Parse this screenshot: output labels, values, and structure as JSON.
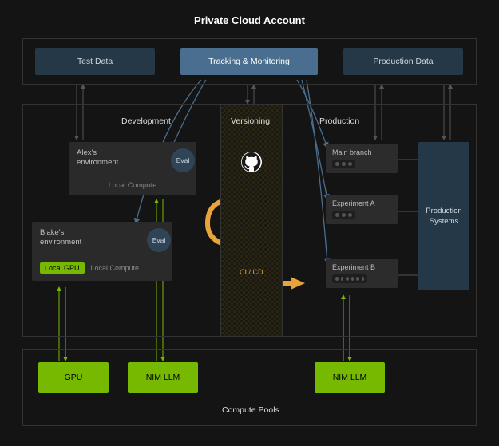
{
  "title": "Private Cloud Account",
  "top": {
    "test_data": "Test Data",
    "tracking": "Tracking & Monitoring",
    "prod_data": "Production Data"
  },
  "sections": {
    "development": "Development",
    "versioning": "Versioning",
    "production": "Production"
  },
  "envs": {
    "alex": {
      "title": "Alex's\nenvironment",
      "eval": "Eval",
      "compute": "Local Compute"
    },
    "blake": {
      "title": "Blake's\nenvironment",
      "eval": "Eval",
      "gpu": "Local GPU",
      "compute": "Local Compute"
    }
  },
  "cicd": "CI / CD",
  "branches": {
    "main": "Main branch",
    "expA": "Experiment A",
    "expB": "Experiment B"
  },
  "prod_systems": "Production\nSystems",
  "compute": {
    "gpu": "GPU",
    "nim1": "NIM LLM",
    "nim2": "NIM LLM",
    "label": "Compute Pools"
  }
}
